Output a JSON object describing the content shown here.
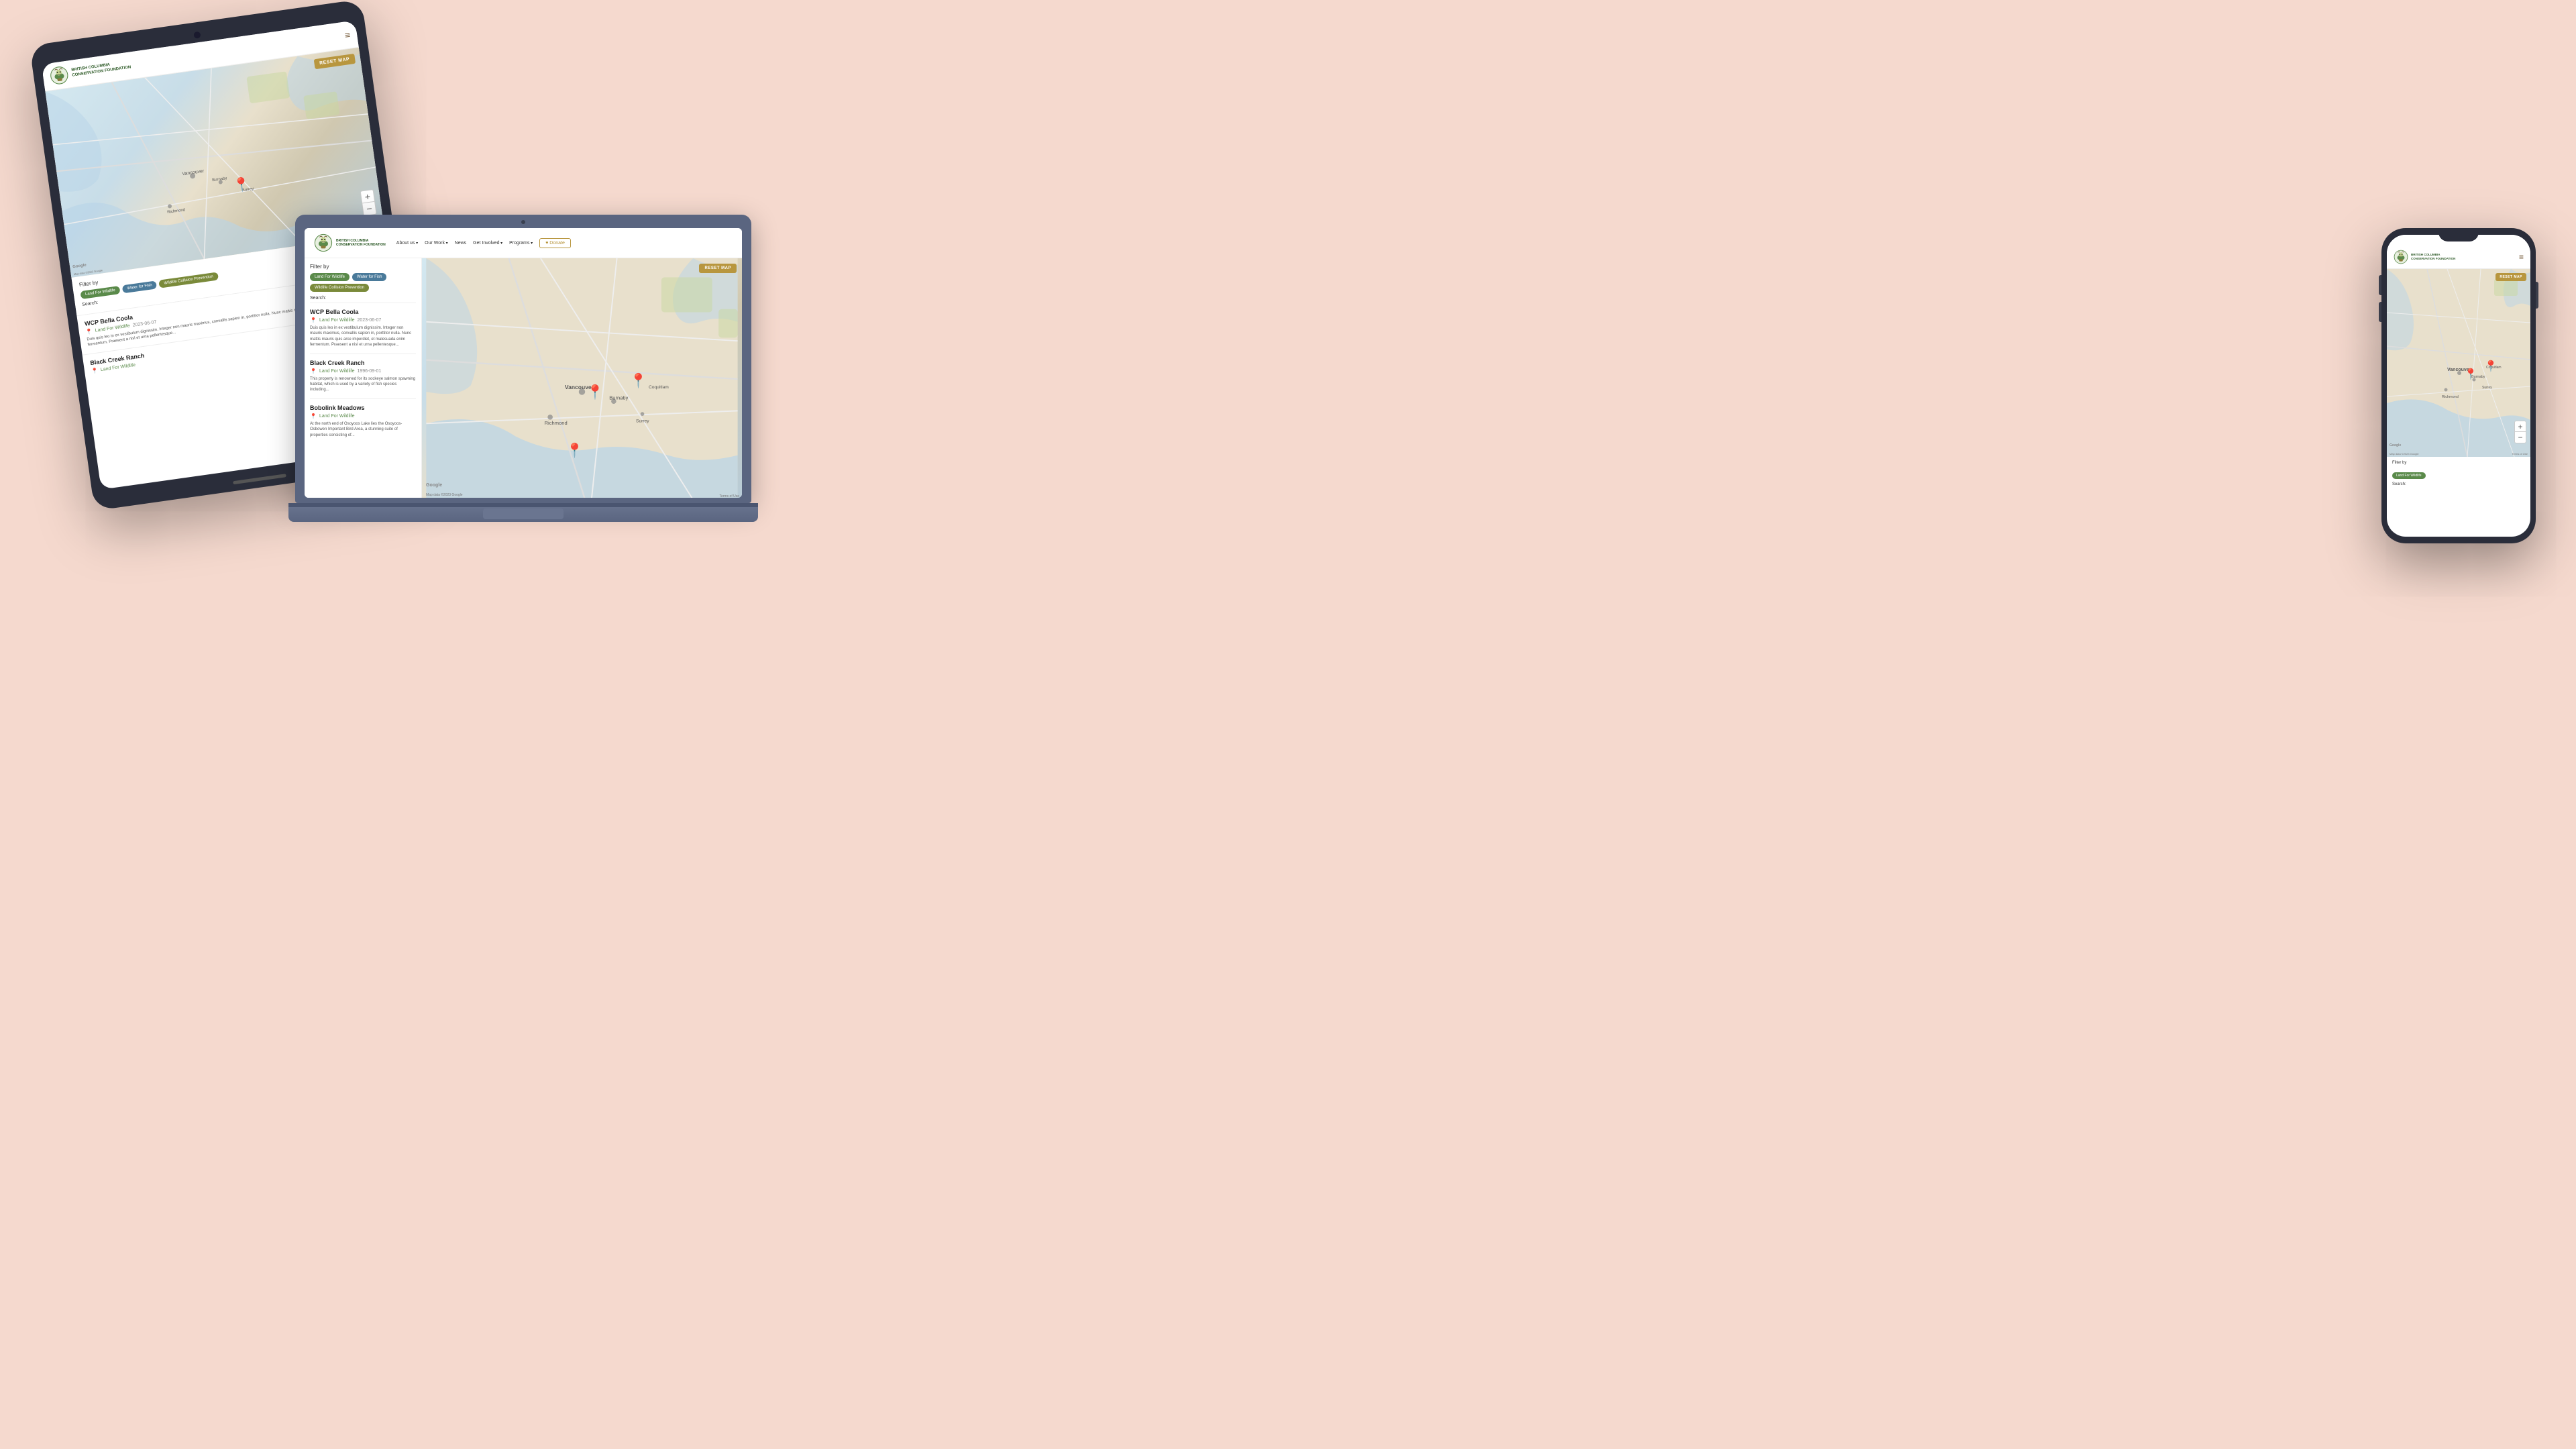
{
  "brand": {
    "name_line1": "BRITISH COLUMBIA",
    "name_line2": "CONSERVATION FOUNDATION",
    "full_name": "COLUMBiA conservaTion FoundaTion"
  },
  "nav": {
    "about": "About us",
    "our_work": "Our Work",
    "news": "News",
    "get_involved": "Get Involved",
    "programs": "Programs",
    "donate": "♥ Donate"
  },
  "map": {
    "reset_button": "RESET MAP",
    "zoom_in": "+",
    "zoom_out": "−",
    "attribution": "Map data ©2023 Google",
    "terms": "Terms of Use"
  },
  "filters": {
    "label": "Filter by",
    "buttons": [
      {
        "id": "land-for-wildlife",
        "label": "Land For Wildlife",
        "active": true,
        "color": "green"
      },
      {
        "id": "water-for-fish",
        "label": "Water for Fish",
        "active": false,
        "color": "blue"
      },
      {
        "id": "wildlife-collision-prevention",
        "label": "Wildlife Collision Prevention",
        "active": false,
        "color": "olive"
      }
    ],
    "search_label": "Search:"
  },
  "listings": [
    {
      "id": 1,
      "title": "WCP Bella Coola",
      "tag": "Land For Wildlife",
      "date": "2023-06-07",
      "description": "Duis quis leo in ex vestibulum dignissim. Integer non mauris maximus, convallis sapien in, porttitor nulla. Nunc mattis mauris quis arce imperdiet, et malesuada enim fermentum. Praesent a nisl et urna pellentesque..."
    },
    {
      "id": 2,
      "title": "Black Creek Ranch",
      "tag": "Land For Wildlife",
      "date": "1996-09-01",
      "description": "This property is renowned for its sockeye salmon spawning habitat, which is used by a variety of fish species including..."
    },
    {
      "id": 3,
      "title": "Bobolink Meadows",
      "tag": "Land For Wildlife",
      "date": "",
      "description": "At the north end of Osoyoos Lake lies the Osoyoos-Osbowen Important Bird Area, a stunning suite of properties consisting of..."
    }
  ],
  "hamburger_icon": "≡",
  "pin_symbol": "📍",
  "colors": {
    "background": "#f5d9ce",
    "green": "#5a8a4a",
    "blue": "#4a7a9a",
    "olive": "#7a8a3a",
    "gold": "#b8963e",
    "dark_text": "#222",
    "brand_green": "#2d5a27"
  }
}
